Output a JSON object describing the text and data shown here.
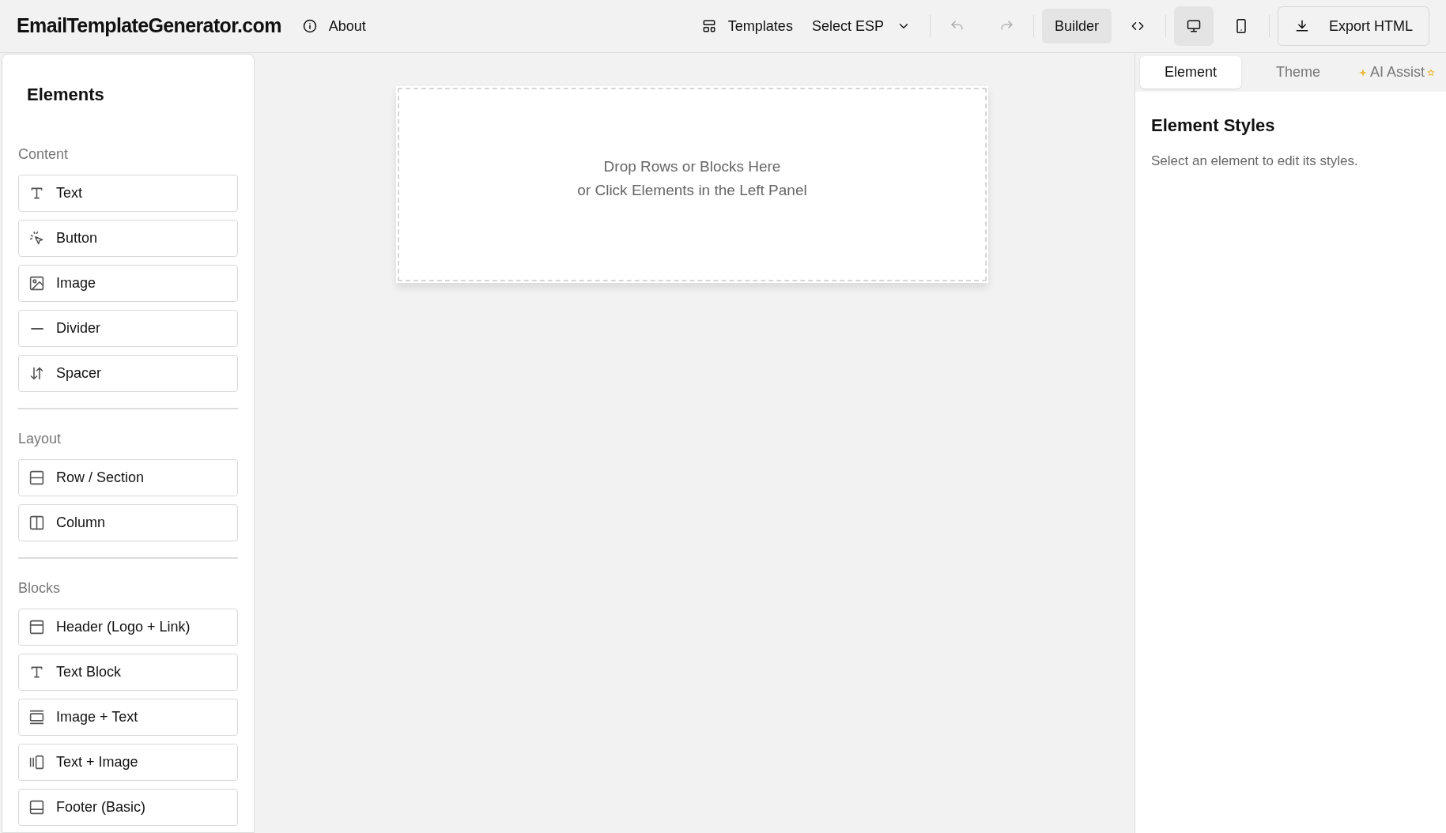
{
  "header": {
    "brand": "EmailTemplateGenerator.com",
    "about": "About",
    "toolbar": {
      "templates": "Templates",
      "select_esp": "Select ESP",
      "undo_disabled": true,
      "redo_disabled": true,
      "views": [
        {
          "kind": "builder",
          "label": "Builder",
          "selected": true
        },
        {
          "kind": "code",
          "selected": false
        }
      ],
      "devices": [
        {
          "kind": "desktop",
          "selected": true
        },
        {
          "kind": "mobile",
          "selected": false
        }
      ],
      "export": "Export HTML"
    }
  },
  "sidebar": {
    "title": "Elements",
    "sections": [
      {
        "label": "Content",
        "items": [
          {
            "kind": "text",
            "label": "Text"
          },
          {
            "kind": "button",
            "label": "Button"
          },
          {
            "kind": "image",
            "label": "Image"
          },
          {
            "kind": "divider",
            "label": "Divider"
          },
          {
            "kind": "spacer",
            "label": "Spacer"
          }
        ]
      },
      {
        "label": "Layout",
        "items": [
          {
            "kind": "row",
            "label": "Row / Section"
          },
          {
            "kind": "column",
            "label": "Column"
          }
        ]
      },
      {
        "label": "Blocks",
        "items": [
          {
            "kind": "header",
            "label": "Header (Logo + Link)"
          },
          {
            "kind": "text",
            "label": "Text Block"
          },
          {
            "kind": "image-text",
            "label": "Image + Text"
          },
          {
            "kind": "text-image",
            "label": "Text + Image"
          },
          {
            "kind": "footer",
            "label": "Footer (Basic)"
          }
        ]
      }
    ]
  },
  "canvas": {
    "drop_hint": [
      "Drop Rows or Blocks Here",
      "or Click Elements in the Left Panel"
    ]
  },
  "inspector": {
    "tabs": [
      {
        "label": "Element",
        "selected": true
      },
      {
        "label": "Theme",
        "selected": false
      },
      {
        "label": "AI Assist",
        "selected": false
      }
    ],
    "title": "Element Styles",
    "hint": "Select an element to edit its styles."
  }
}
